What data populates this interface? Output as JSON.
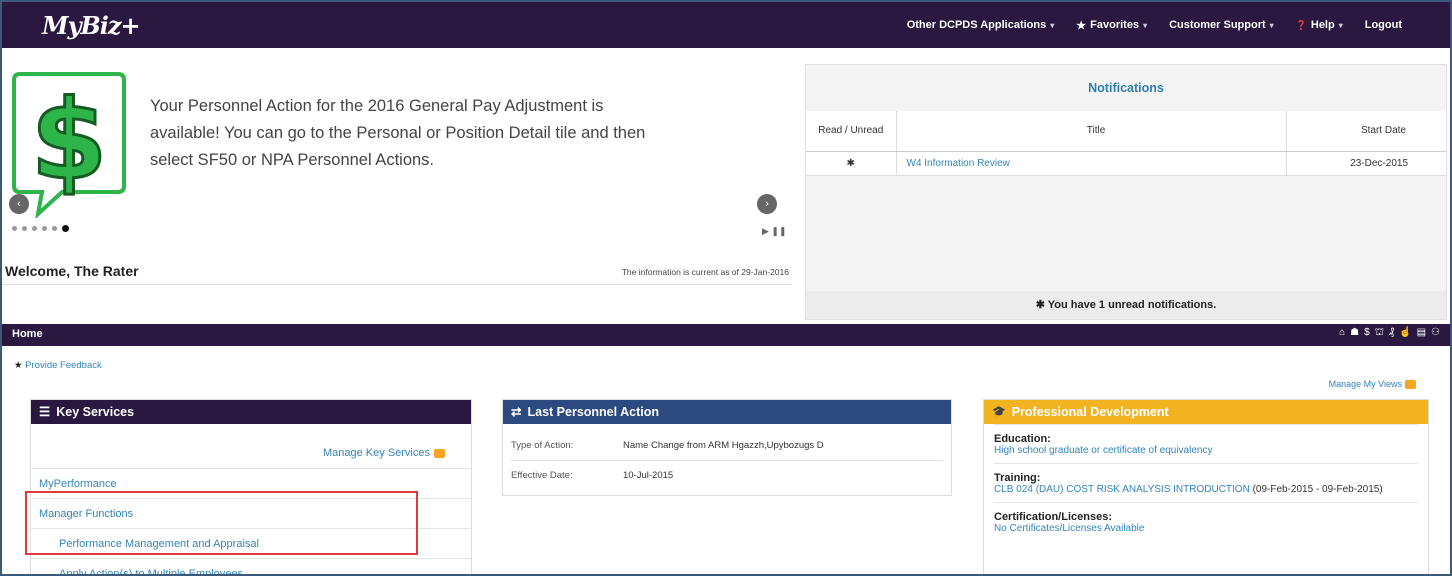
{
  "header": {
    "logo": "MyBiz+",
    "nav": [
      {
        "label": "Other DCPDS Applications",
        "caret": "▾"
      },
      {
        "label": "Favorites",
        "icon": "★",
        "caret": "▾"
      },
      {
        "label": "Customer Support",
        "caret": "▾"
      },
      {
        "label": "Help",
        "icon": "❓",
        "caret": "▾"
      },
      {
        "label": "Logout"
      }
    ]
  },
  "banner": {
    "message": "Your Personnel Action for the 2016 General Pay Adjustment is available! You can go to the Personal or Position Detail tile and then select SF50 or NPA Personnel Actions.",
    "dollar_glyph": "$",
    "prev_glyph": "‹",
    "next_glyph": "›",
    "playpause_glyph": "▶ ❚❚",
    "slide_count": 6,
    "active_slide": 6,
    "welcome": "Welcome, The Rater",
    "current_as_of": "The information is current as of 29-Jan-2016"
  },
  "notifications": {
    "title": "Notifications",
    "columns": [
      "Read / Unread",
      "Title",
      "Start Date"
    ],
    "rows": [
      {
        "read_icon": "✱",
        "title": "W4 Information Review",
        "start_date": "23-Dec-2015"
      }
    ],
    "footer": "You have 1 unread notifications.",
    "footer_icon": "✱"
  },
  "homebar": {
    "title": "Home",
    "icons": [
      "home-icon",
      "user-icon",
      "dollar-icon",
      "graduation-icon",
      "pay-icon",
      "thumbs-up-icon",
      "document-icon",
      "org-chart-icon"
    ],
    "glyphs": [
      "⌂",
      "☗",
      "$",
      "⛫",
      "₰",
      "☝",
      "▤",
      "⚇"
    ]
  },
  "feedback": {
    "icon": "★",
    "label": "Provide Feedback"
  },
  "manage_views": "Manage My Views",
  "key_services": {
    "title": "Key Services",
    "icon": "☰",
    "manage_label": "Manage Key Services",
    "items": [
      {
        "label": "MyPerformance",
        "sub": false
      },
      {
        "label": "Manager Functions",
        "sub": false
      },
      {
        "label": "Performance Management and Appraisal",
        "sub": true
      },
      {
        "label": "Apply Action(s) to Multiple Employees",
        "sub": true
      }
    ]
  },
  "last_personnel_action": {
    "title": "Last Personnel Action",
    "icon": "⇄",
    "rows": [
      {
        "label": "Type of Action:",
        "value": "Name Change from ARM Hgazzh,Upybozugs D"
      },
      {
        "label": "Effective Date:",
        "value": "10-Jul-2015"
      }
    ]
  },
  "professional_development": {
    "title": "Professional Development",
    "icon": "🎓",
    "education_label": "Education:",
    "education_value": "High school graduate or certificate of equivalency",
    "training_label": "Training:",
    "training_link": "CLB 024 (DAU) COST RISK ANALYSIS INTRODUCTION",
    "training_dates": " (09-Feb-2015 - 09-Feb-2015)",
    "cert_label": "Certification/Licenses:",
    "cert_value": "No Certificates/Licenses Available"
  },
  "colors": {
    "nav_bg": "#2a1840",
    "link": "#3385b8",
    "lpa_header": "#2d4a80",
    "pd_header": "#f2b320",
    "dollar_green": "#2db54a",
    "highlight": "#e03a3a"
  }
}
